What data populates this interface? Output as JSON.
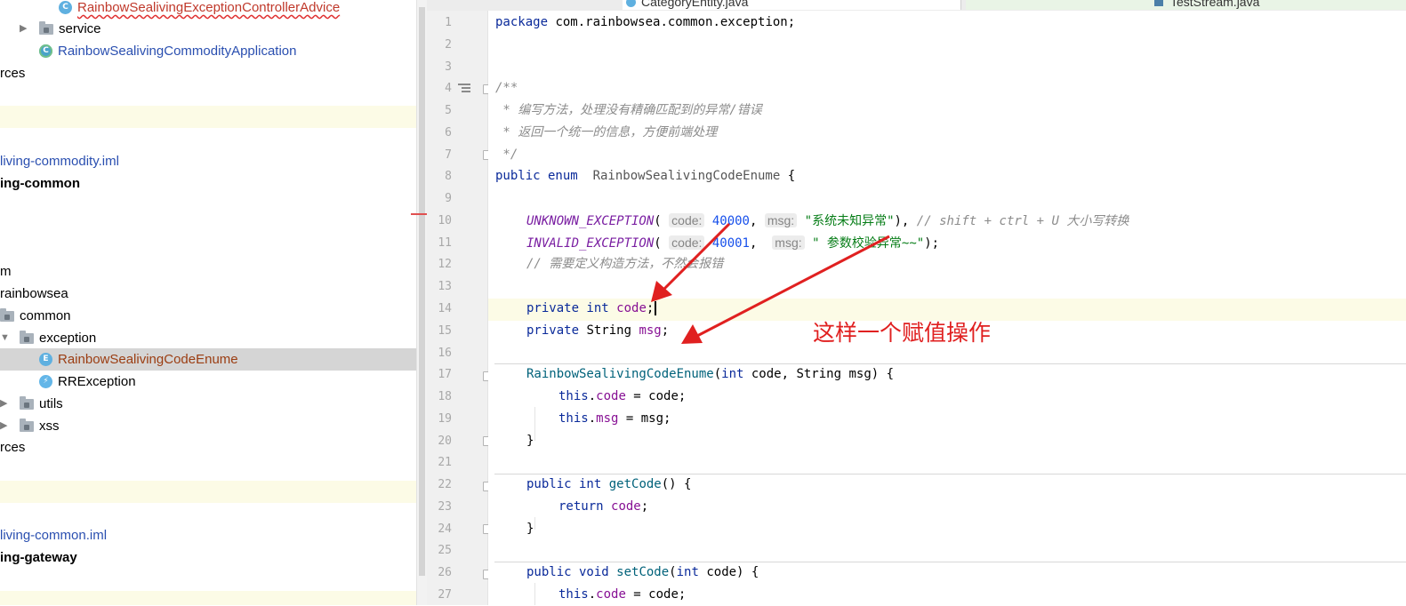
{
  "tabs": [
    {
      "label": "CategoryEntity.java"
    },
    {
      "label": "TestStream.java"
    }
  ],
  "project_tree": {
    "items": [
      {
        "label": "RainbowSealivingExceptionControllerAdvice"
      },
      {
        "label": "service"
      },
      {
        "label": "RainbowSealivingCommodityApplication"
      },
      {
        "label": "rces"
      },
      {
        "label": "living-commodity.iml"
      },
      {
        "label": "ing-common"
      },
      {
        "label": "m"
      },
      {
        "label": "rainbowsea"
      },
      {
        "label": "common"
      },
      {
        "label": "exception"
      },
      {
        "label": "RainbowSealivingCodeEnume"
      },
      {
        "label": "RRException"
      },
      {
        "label": "utils"
      },
      {
        "label": "xss"
      },
      {
        "label": "rces"
      },
      {
        "label": "living-common.iml"
      },
      {
        "label": "ing-gateway"
      }
    ]
  },
  "editor": {
    "line_numbers": [
      "1",
      "2",
      "3",
      "4",
      "5",
      "6",
      "7",
      "8",
      "9",
      "10",
      "11",
      "12",
      "13",
      "14",
      "15",
      "16",
      "17",
      "18",
      "19",
      "20",
      "21",
      "22",
      "23",
      "24",
      "25",
      "26",
      "27"
    ],
    "code": {
      "l1_kw": "package",
      "l1_rest": " com.rainbowsea.common.exception;",
      "l4": "/**",
      "l5": " * 编写方法，处理没有精确匹配到的异常/错误",
      "l6": " * 返回一个统一的信息，方便前端处理",
      "l7": " */",
      "l8_kw": "public enum",
      "l8_name": "  RainbowSealivingCodeEnume",
      "l8_brace": " {",
      "l10_enum": "UNKNOWN_EXCEPTION",
      "l10_hint1": "code:",
      "l10_num": "40000",
      "l10_hint2": "msg:",
      "l10_str": "\"系统未知异常\"",
      "l10_cmt": "// shift + ctrl + U 大小写转换",
      "l11_enum": "INVALID_EXCEPTION",
      "l11_hint1": "code:",
      "l11_num": "40001",
      "l11_hint2": "msg:",
      "l11_str": "\" 参数校验异常~~\"",
      "l12": "// 需要定义构造方法，不然会报错",
      "l14_kw": "private int",
      "l14_field": "code",
      "l15_kw": "private",
      "l15_type": " String ",
      "l15_field": "msg",
      "l17_name": "RainbowSealivingCodeEnume",
      "l17_kw1": "int",
      "l17_p1": " code, String msg) {",
      "l18_kw": "this",
      "l18_field": "code",
      "l18_rest": " = code;",
      "l19_kw": "this",
      "l19_field": "msg",
      "l19_rest": " = msg;",
      "l20": "}",
      "l22_kw": "public int",
      "l22_method": "getCode",
      "l22_rest": "() {",
      "l23_kw": "return",
      "l23_field": "code",
      "l24": "}",
      "l26_kw": "public void",
      "l26_method": "setCode",
      "l26_kw2": "int",
      "l26_rest": " code) {",
      "l27_kw": "this",
      "l27_field": "code",
      "l27_rest": " = code;"
    }
  },
  "annotation": {
    "text": "这样一个赋值操作"
  },
  "colors": {
    "keyword": "#0a2a9a",
    "comment": "#8c8c8c",
    "enum_constant": "#7a1fa2",
    "number": "#1750eb",
    "string": "#067d17",
    "field": "#871094",
    "annotation_red": "#e02020",
    "current_line": "#fcfbe6",
    "selection": "#d5d5d5"
  }
}
